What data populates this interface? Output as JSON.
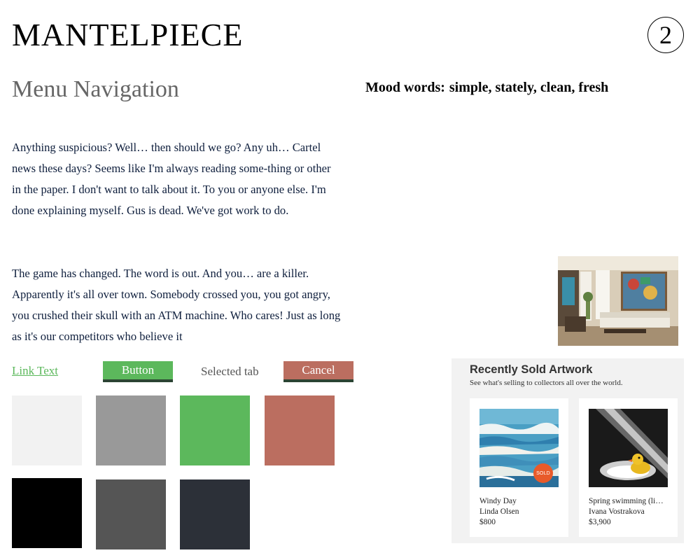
{
  "header": {
    "brand": "MANTELPIECE",
    "page_number": "2"
  },
  "section": {
    "title": "Menu Navigation"
  },
  "mood": {
    "label": "Mood words:",
    "value": "simple, stately, clean, fresh"
  },
  "body": {
    "paragraph_1": "Anything suspicious? Well… then should we go? Any uh… Cartel news these days? Seems like I'm always reading some-thing or other in the paper. I don't want to talk about it. To you or anyone else. I'm done explaining myself. Gus is dead. We've got work to do.",
    "paragraph_2": "The game has changed. The word is out. And you… are a killer. Apparently it's all over town. Somebody crossed you, you got angry, you crushed their skull with an ATM machine. Who cares! Just as long as it's our competitors who believe it"
  },
  "controls": {
    "link_text": "Link Text",
    "button_label": "Button",
    "selected_tab": "Selected tab",
    "cancel_label": "Cancel"
  },
  "palette": {
    "row_1": [
      "#f2f2f2",
      "#999999",
      "#5cb85c",
      "#bb6e60"
    ],
    "row_2": [
      "#000000",
      "#555555",
      "#2c3038"
    ]
  },
  "recently_sold": {
    "title": "Recently Sold Artwork",
    "subtitle": "See what's selling to collectors all over the world.",
    "items": [
      {
        "title": "Windy Day",
        "artist": "Linda Olsen",
        "price": "$800",
        "badge": "SOLD"
      },
      {
        "title": "Spring swimming (li…",
        "artist": "Ivana Vostrakova",
        "price": "$3,900"
      }
    ]
  },
  "icons": {
    "page_badge": "circle-number",
    "room_photo": "living-room-image",
    "artwork_1": "seascape-painting-image",
    "artwork_2": "rubber-duck-photo-image"
  }
}
